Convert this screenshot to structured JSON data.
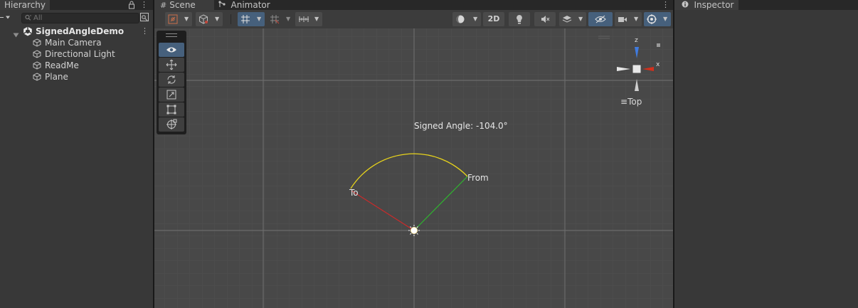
{
  "hierarchy": {
    "tab_label": "Hierarchy",
    "search_placeholder": "All",
    "scene_name": "SignedAngleDemo",
    "items": [
      {
        "label": "Main Camera"
      },
      {
        "label": "Directional Light"
      },
      {
        "label": "ReadMe"
      },
      {
        "label": "Plane"
      }
    ]
  },
  "scene_tabs": [
    {
      "label": "Scene",
      "icon": "grid-icon"
    },
    {
      "label": "Animator",
      "icon": "animator-icon"
    }
  ],
  "toolbar": {
    "mode_2d_label": "2D"
  },
  "viewport": {
    "angle_label": "Signed Angle: -104.0°",
    "from_label": "From",
    "to_label": "To",
    "gizmo": {
      "y_axis_label": "z",
      "x_axis_label": "x",
      "view_label": "Top"
    },
    "colors": {
      "arc": "#e6d21c",
      "to_line": "#cc2a2a",
      "from_line": "#2fb52f",
      "axis_blue": "#3f7be0",
      "axis_red": "#d4301c"
    }
  },
  "inspector": {
    "tab_label": "Inspector"
  }
}
